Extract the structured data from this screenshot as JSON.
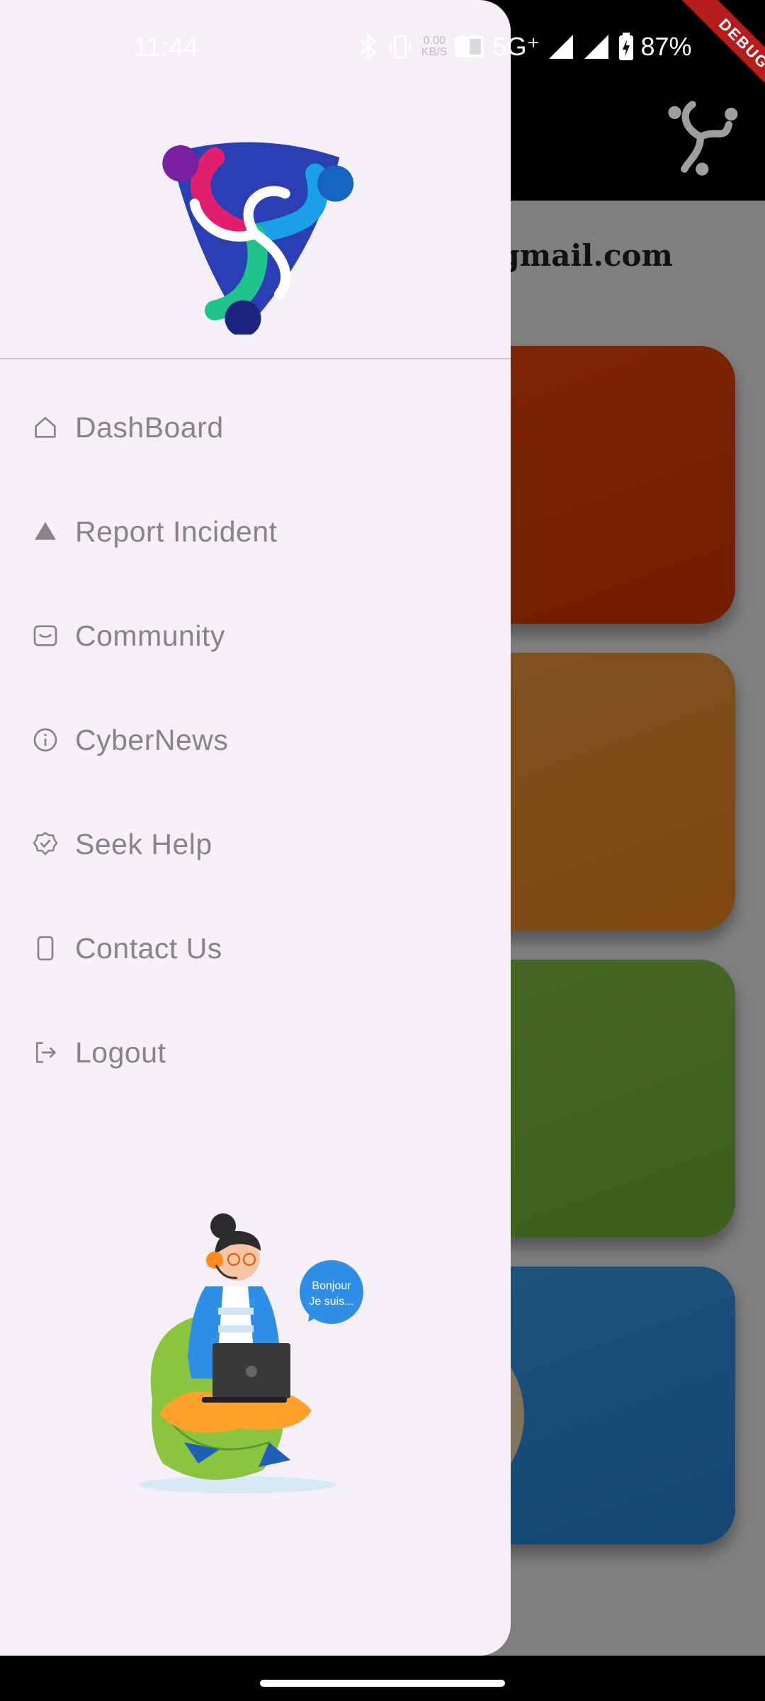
{
  "status_bar": {
    "time": "11:44",
    "net_speed_value": "0.00",
    "net_speed_unit": "KB/S",
    "network": "5G⁺",
    "battery": "87%",
    "debug_label": "DEBUG"
  },
  "background": {
    "email_fragment": "ogmail.com",
    "tiles": [
      {
        "name": "report",
        "color": "#ff4a0f"
      },
      {
        "name": "community",
        "color": "#ff9d36"
      },
      {
        "name": "bully",
        "color": "#86c946"
      },
      {
        "name": "news",
        "color": "#379bf6"
      }
    ]
  },
  "drawer": {
    "menu": [
      {
        "label": "DashBoard",
        "icon": "home-icon"
      },
      {
        "label": "Report Incident",
        "icon": "triangle-icon"
      },
      {
        "label": "Community",
        "icon": "message-icon"
      },
      {
        "label": "CyberNews",
        "icon": "info-icon"
      },
      {
        "label": "Seek Help",
        "icon": "verified-icon"
      },
      {
        "label": "Contact Us",
        "icon": "phone-icon"
      },
      {
        "label": "Logout",
        "icon": "logout-icon"
      }
    ],
    "illustration_bubble": [
      "Bonjour",
      "Je suis..."
    ]
  },
  "colors": {
    "drawer_bg": "#f5eff7",
    "menu_text": "#87838a",
    "scrim": "rgba(0,0,0,0.5)"
  }
}
